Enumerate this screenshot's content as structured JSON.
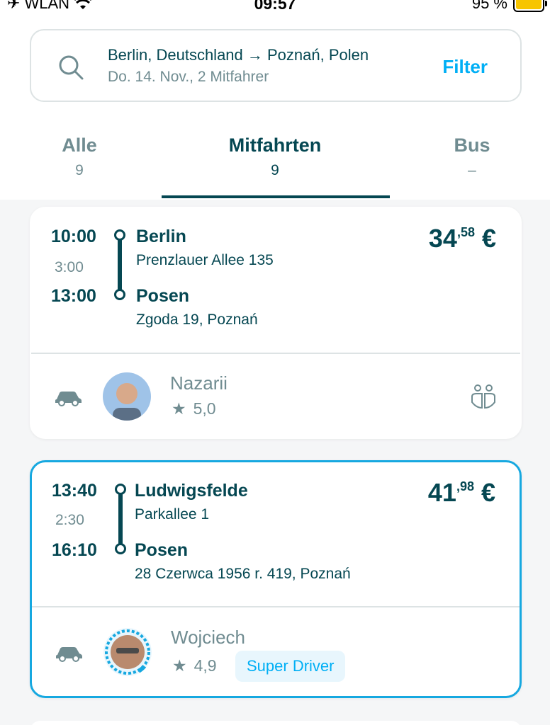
{
  "status_bar": {
    "carrier": "WLAN",
    "time": "09:57",
    "battery": "95 %",
    "battery_level": 0.95
  },
  "search": {
    "route": "Berlin, Deutschland → Poznań, Polen",
    "details": "Do. 14. Nov., 2 Mitfahrer",
    "filter_label": "Filter"
  },
  "tabs": [
    {
      "label": "Alle",
      "count": "9"
    },
    {
      "label": "Mitfahrten",
      "count": "9"
    },
    {
      "label": "Bus",
      "count": "–"
    }
  ],
  "rides": [
    {
      "departure_time": "10:00",
      "duration": "3:00",
      "arrival_time": "13:00",
      "from_city": "Berlin",
      "from_address": "Prenzlauer Allee 135",
      "to_city": "Posen",
      "to_address": "Zgoda 19, Poznań",
      "price_main": "34",
      "price_cents": ",58",
      "currency": "€",
      "driver_name": "Nazarii",
      "rating": "5,0",
      "badge": ""
    },
    {
      "departure_time": "13:40",
      "duration": "2:30",
      "arrival_time": "16:10",
      "from_city": "Ludwigsfelde",
      "from_address": "Parkallee 1",
      "to_city": "Posen",
      "to_address": "28 Czerwca 1956 r. 419, Poznań",
      "price_main": "41",
      "price_cents": ",98",
      "currency": "€",
      "driver_name": "Wojciech",
      "rating": "4,9",
      "badge": "Super Driver"
    }
  ],
  "colors": {
    "primary": "#054752",
    "accent": "#00aff5",
    "muted": "#708c91",
    "highlight_border": "#16a8e0"
  }
}
